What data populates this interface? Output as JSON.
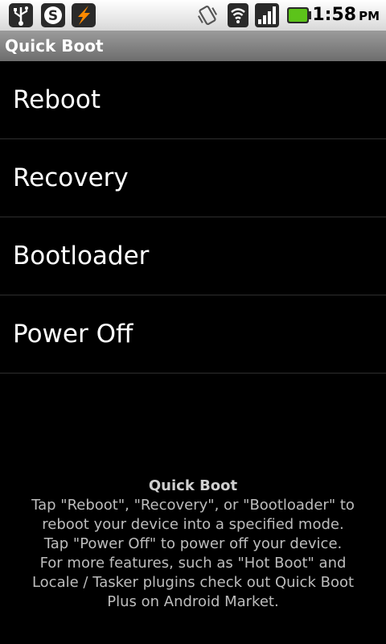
{
  "status_bar": {
    "icons": [
      "usb-icon",
      "skype-icon",
      "flash-app-icon",
      "vibrate-icon",
      "wifi-icon",
      "signal-icon",
      "battery-icon"
    ],
    "time": "1:58",
    "ampm": "PM"
  },
  "title_bar": {
    "title": "Quick Boot"
  },
  "menu": {
    "items": [
      {
        "label": "Reboot"
      },
      {
        "label": "Recovery"
      },
      {
        "label": "Bootloader"
      },
      {
        "label": "Power Off"
      }
    ]
  },
  "help": {
    "title": "Quick Boot",
    "lines": [
      "Tap \"Reboot\", \"Recovery\", or \"Bootloader\" to",
      "reboot your device into a specified mode.",
      "Tap \"Power Off\" to power off your device.",
      "For more features, such as \"Hot Boot\" and",
      "Locale / Tasker plugins check out Quick Boot",
      "Plus on Android Market."
    ]
  },
  "colors": {
    "battery": "#5cc31a",
    "accent": "#ff8a00",
    "background": "#000000"
  }
}
